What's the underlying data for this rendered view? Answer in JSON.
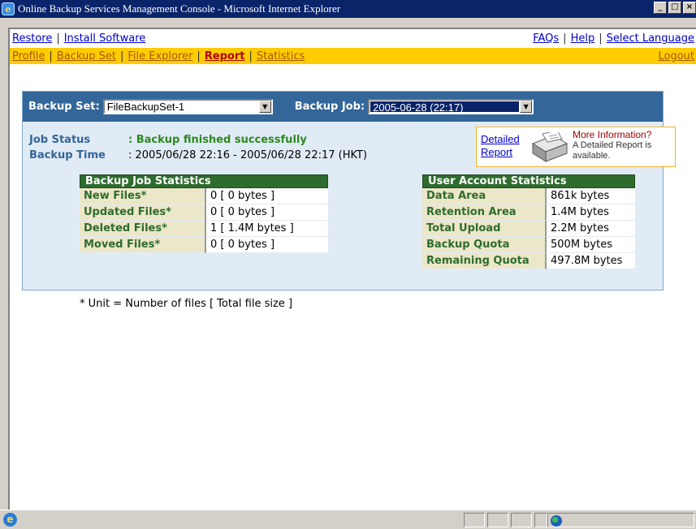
{
  "window": {
    "title": "Online Backup Services Management Console - Microsoft Internet Explorer"
  },
  "nav_top": {
    "left": [
      "Restore",
      "Install Software"
    ],
    "right": [
      "FAQs",
      "Help",
      "Select Language"
    ]
  },
  "nav_main": {
    "items": [
      "Profile",
      "Backup Set",
      "File Explorer",
      "Report",
      "Statistics"
    ],
    "active": "Report",
    "logout": "Logout"
  },
  "filters": {
    "backup_set_label": "Backup Set:",
    "backup_set_value": "FileBackupSet-1",
    "backup_job_label": "Backup Job:",
    "backup_job_value": "2005-06-28 (22:17)"
  },
  "status": {
    "job_status_label": "Job Status",
    "job_status_value": ": Backup finished successfully",
    "backup_time_label": "Backup Time",
    "backup_time_value": ": 2005/06/28 22:16 - 2005/06/28 22:17 (HKT)"
  },
  "detailed_report": {
    "link_line1": "Detailed",
    "link_line2": "Report",
    "more_info": "More Information?",
    "desc_line1": "A Detailed Report is",
    "desc_line2": "available."
  },
  "job_stats": {
    "title": "Backup Job Statistics",
    "rows": [
      {
        "label": "New Files*",
        "value": "0 [ 0 bytes ]"
      },
      {
        "label": "Updated Files*",
        "value": "0 [ 0 bytes ]"
      },
      {
        "label": "Deleted Files*",
        "value": "1 [ 1.4M bytes ]"
      },
      {
        "label": "Moved Files*",
        "value": "0 [ 0 bytes ]"
      }
    ],
    "footnote": "* Unit = Number of files [ Total file size ]"
  },
  "account_stats": {
    "title": "User Account Statistics",
    "rows": [
      {
        "label": "Data Area",
        "value": "861k bytes"
      },
      {
        "label": "Retention Area",
        "value": "1.4M bytes"
      },
      {
        "label": "Total Upload",
        "value": "2.2M bytes"
      },
      {
        "label": "Backup Quota",
        "value": "500M bytes"
      },
      {
        "label": "Remaining Quota",
        "value": "497.8M bytes"
      }
    ]
  },
  "colors": {
    "header_blue": "#336699",
    "nav_yellow": "#ffcc00",
    "table_green": "#2e6b2e",
    "success_green": "#2b8a1f"
  }
}
